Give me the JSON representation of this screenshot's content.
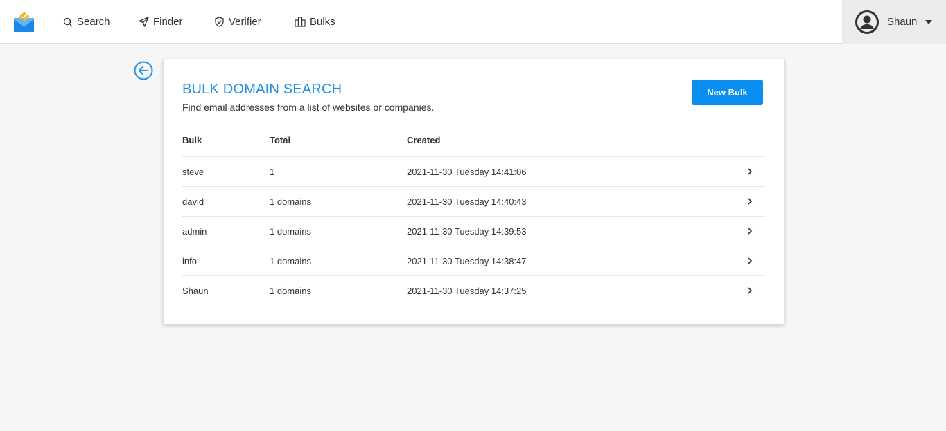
{
  "nav": {
    "items": [
      {
        "label": "Search",
        "icon": "search-icon"
      },
      {
        "label": "Finder",
        "icon": "send-icon"
      },
      {
        "label": "Verifier",
        "icon": "shield-check-icon"
      },
      {
        "label": "Bulks",
        "icon": "buildings-icon"
      }
    ],
    "user": {
      "name": "Shaun",
      "icon": "avatar-icon"
    }
  },
  "colors": {
    "accent": "#1d8fe6",
    "button": "#0a8ff0",
    "logo_blue": "#1e88e5",
    "logo_yellow": "#f5b82e"
  },
  "card": {
    "title": "BULK DOMAIN SEARCH",
    "subtitle": "Find email addresses from a list of websites or companies.",
    "new_bulk_label": "New Bulk",
    "columns": {
      "bulk": "Bulk",
      "total": "Total",
      "created": "Created"
    },
    "rows": [
      {
        "bulk": "steve",
        "total": "1",
        "created": "2021-11-30 Tuesday 14:41:06"
      },
      {
        "bulk": "david",
        "total": "1 domains",
        "created": "2021-11-30 Tuesday 14:40:43"
      },
      {
        "bulk": "admin",
        "total": "1 domains",
        "created": "2021-11-30 Tuesday 14:39:53"
      },
      {
        "bulk": "info",
        "total": "1 domains",
        "created": "2021-11-30 Tuesday 14:38:47"
      },
      {
        "bulk": "Shaun",
        "total": "1 domains",
        "created": "2021-11-30 Tuesday 14:37:25"
      }
    ]
  }
}
